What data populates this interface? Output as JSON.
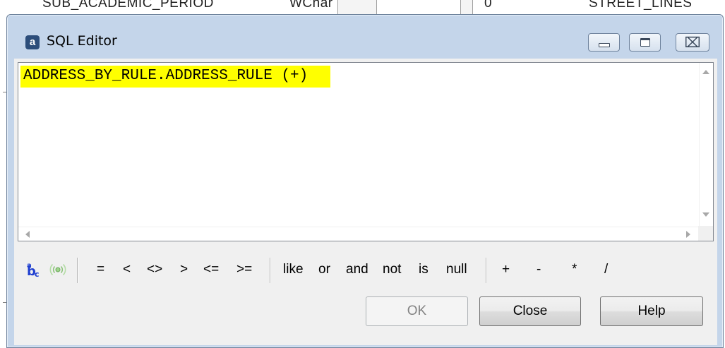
{
  "background": {
    "left_text": "SUB_ACADEMIC_PERIOD",
    "type_text": "WChar",
    "digit_text": "0",
    "right_text": "STREET_LINES"
  },
  "window": {
    "title": "SQL Editor",
    "app_icon_letter": "a",
    "controls": {
      "minimize_icon": "minimize-icon",
      "maximize_icon": "maximize-icon",
      "close_glyph": "⌧"
    }
  },
  "editor": {
    "content": "ADDRESS_BY_RULE.ADDRESS_RULE (+)",
    "highlight_color": "#ffff00"
  },
  "toolbar": {
    "icons": [
      "abc-format-icon",
      "radio-wave-icon"
    ],
    "comparison_ops": [
      "=",
      "<",
      "<>",
      ">",
      "<=",
      ">="
    ],
    "keyword_ops": [
      "like",
      "or",
      "and",
      "not",
      "is",
      "null"
    ],
    "arithmetic_ops": [
      "+",
      "-",
      "*",
      "/"
    ]
  },
  "buttons": {
    "ok": "OK",
    "close": "Close",
    "help": "Help"
  },
  "colors": {
    "window_frame": "#c4d5ea",
    "client": "#f0f0f0",
    "accent_blue": "#1f3fd0"
  }
}
